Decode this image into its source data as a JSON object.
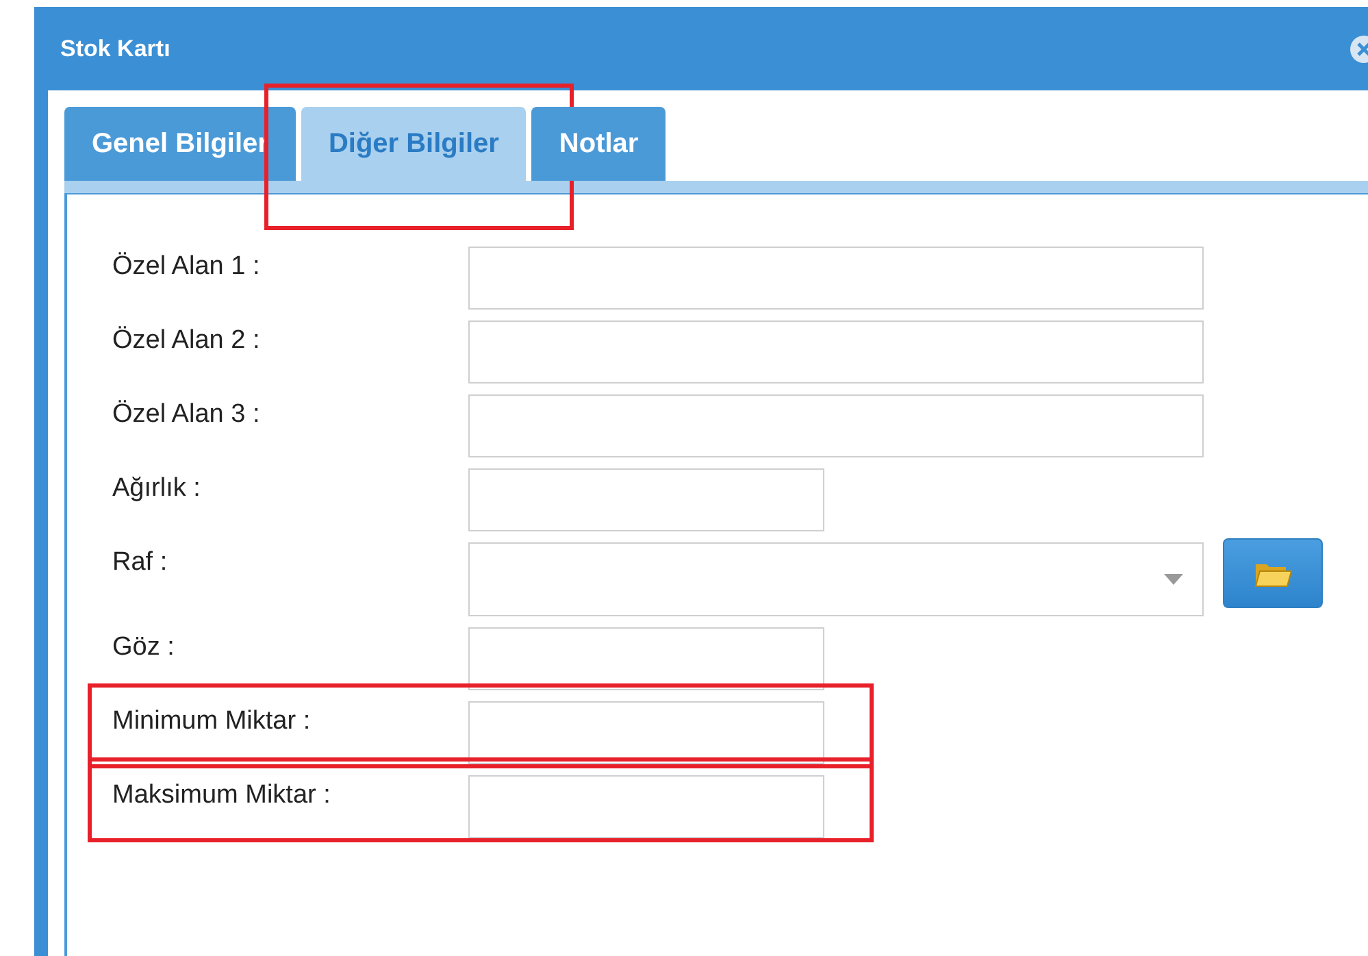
{
  "window": {
    "title": "Stok Kartı"
  },
  "tabs": [
    {
      "label": "Genel Bilgiler",
      "selected": false,
      "highlighted": false
    },
    {
      "label": "Diğer Bilgiler",
      "selected": true,
      "highlighted": true
    },
    {
      "label": "Notlar",
      "selected": false,
      "highlighted": false
    }
  ],
  "fields": [
    {
      "label": "Özel Alan 1 :",
      "kind": "wide",
      "highlighted": false
    },
    {
      "label": "Özel Alan 2 :",
      "kind": "wide",
      "highlighted": false
    },
    {
      "label": "Özel Alan 3 :",
      "kind": "wide",
      "highlighted": false
    },
    {
      "label": "Ağırlık :",
      "kind": "short",
      "highlighted": false
    },
    {
      "label": "Raf :",
      "kind": "select",
      "highlighted": false
    },
    {
      "label": "Göz :",
      "kind": "short",
      "highlighted": false
    },
    {
      "label": "Minimum Miktar :",
      "kind": "short",
      "highlighted": true
    },
    {
      "label": "Maksimum Miktar :",
      "kind": "short",
      "highlighted": true
    }
  ]
}
